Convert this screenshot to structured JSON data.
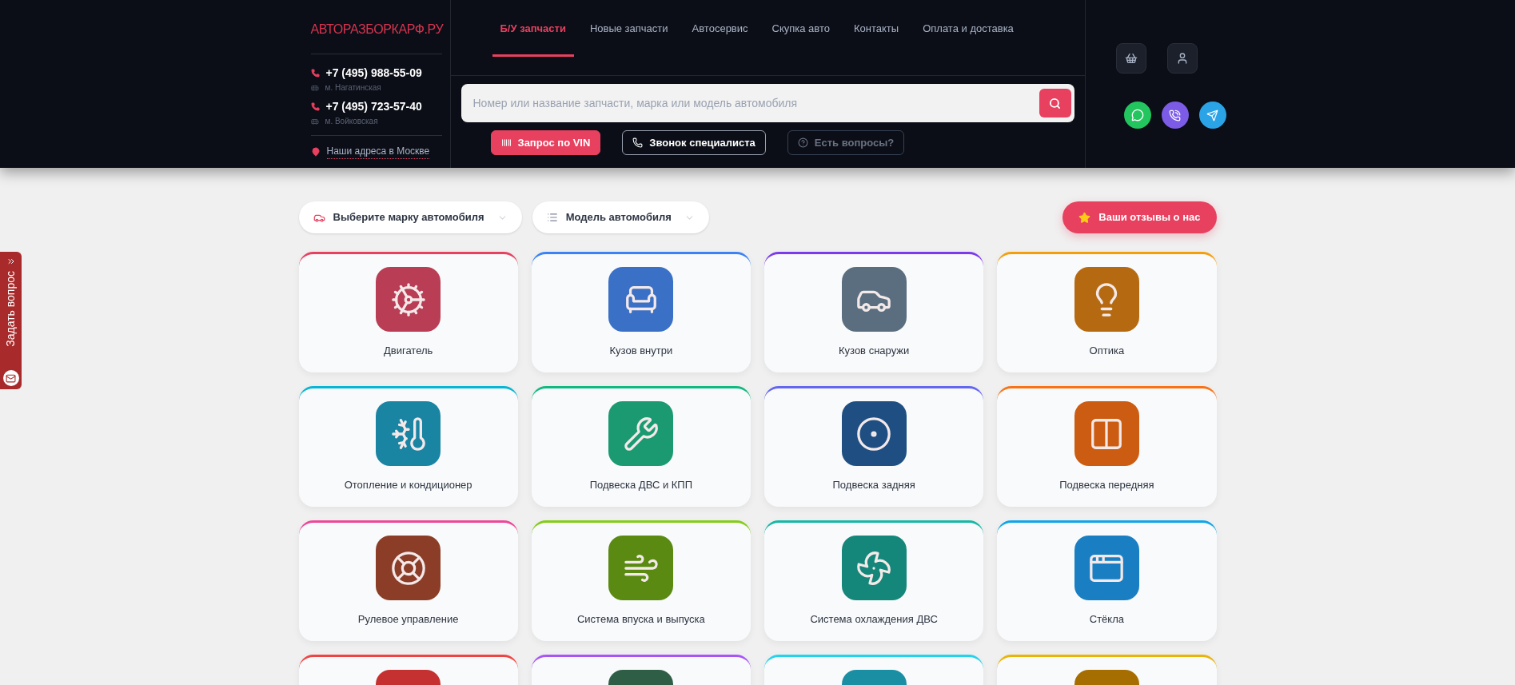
{
  "logo": "АВТОРАЗБОРКАРФ.РУ",
  "phones": [
    {
      "number": "+7 (495) 988-55-09",
      "metro": "м. Нагатинская"
    },
    {
      "number": "+7 (495) 723-57-40",
      "metro": "м. Войковская"
    }
  ],
  "address_link": "Наши адреса в Москве",
  "nav": [
    {
      "label": "Б/У запчасти",
      "selected": true
    },
    {
      "label": "Новые запчасти",
      "selected": false
    },
    {
      "label": "Автосервис",
      "selected": false
    },
    {
      "label": "Скупка авто",
      "selected": false
    },
    {
      "label": "Контакты",
      "selected": false
    },
    {
      "label": "Оплата и доставка",
      "selected": false
    }
  ],
  "search": {
    "placeholder": "Номер или название запчасти, марка или модель автомобиля"
  },
  "actions": [
    {
      "label": "Запрос по VIN",
      "kind": "vin"
    },
    {
      "label": "Звонок специалиста",
      "kind": "call"
    },
    {
      "label": "Есть вопросы?",
      "kind": "question"
    }
  ],
  "filters": [
    {
      "label": "Выберите марку автомобиля",
      "kind": "brand"
    },
    {
      "label": "Модель автомобиля",
      "kind": "model"
    }
  ],
  "reviews_button": "Ваши отзывы о нас",
  "categories": [
    {
      "label": "Двигатель",
      "color": "#e8405f",
      "tile": {
        "color": "#b83d55"
      }
    },
    {
      "label": "Кузов внутри",
      "color": "#3b82f6",
      "tile": {
        "color": "#3a70c5"
      }
    },
    {
      "label": "Кузов снаружи",
      "color": "#7c3aed",
      "tile": {
        "color": "#5a6e80"
      }
    },
    {
      "label": "Оптика",
      "color": "#f59e0b",
      "tile": {
        "color": "#b56a12"
      }
    },
    {
      "label": "Отопление и кондиционер",
      "color": "#06b6d4",
      "tile": {
        "color": "#1a84a3"
      }
    },
    {
      "label": "Подвеска ДВС и КПП",
      "color": "#10b981",
      "tile": {
        "color": "#1b9a72"
      }
    },
    {
      "label": "Подвеска задняя",
      "color": "#6366f1",
      "tile": {
        "color": "#1f4f82"
      }
    },
    {
      "label": "Подвеска передняя",
      "color": "#f97316",
      "tile": {
        "color": "#cc5c11"
      }
    },
    {
      "label": "Рулевое управление",
      "color": "#ec4899",
      "tile": {
        "color": "#8b3d28"
      }
    },
    {
      "label": "Система впуска и выпуска",
      "color": "#84cc16",
      "tile": {
        "color": "#5a8a12"
      }
    },
    {
      "label": "Система охлаждения ДВС",
      "color": "#14b8a6",
      "tile": {
        "color": "#15877a"
      }
    },
    {
      "label": "Стёкла",
      "color": "#0ea5e9",
      "tile": {
        "color": "#1a7fc2"
      }
    },
    {
      "color": "#ef4444",
      "tile": {
        "color": "#c53030"
      }
    },
    {
      "color": "#a855f7",
      "tile": {
        "color": "#2f5e46"
      }
    },
    {
      "color": "#22d3ee",
      "tile": {
        "color": "#1a8fa3"
      }
    },
    {
      "color": "#eab308",
      "tile": {
        "color": "#a66d00"
      }
    }
  ],
  "side_tab": "Задать вопрос"
}
